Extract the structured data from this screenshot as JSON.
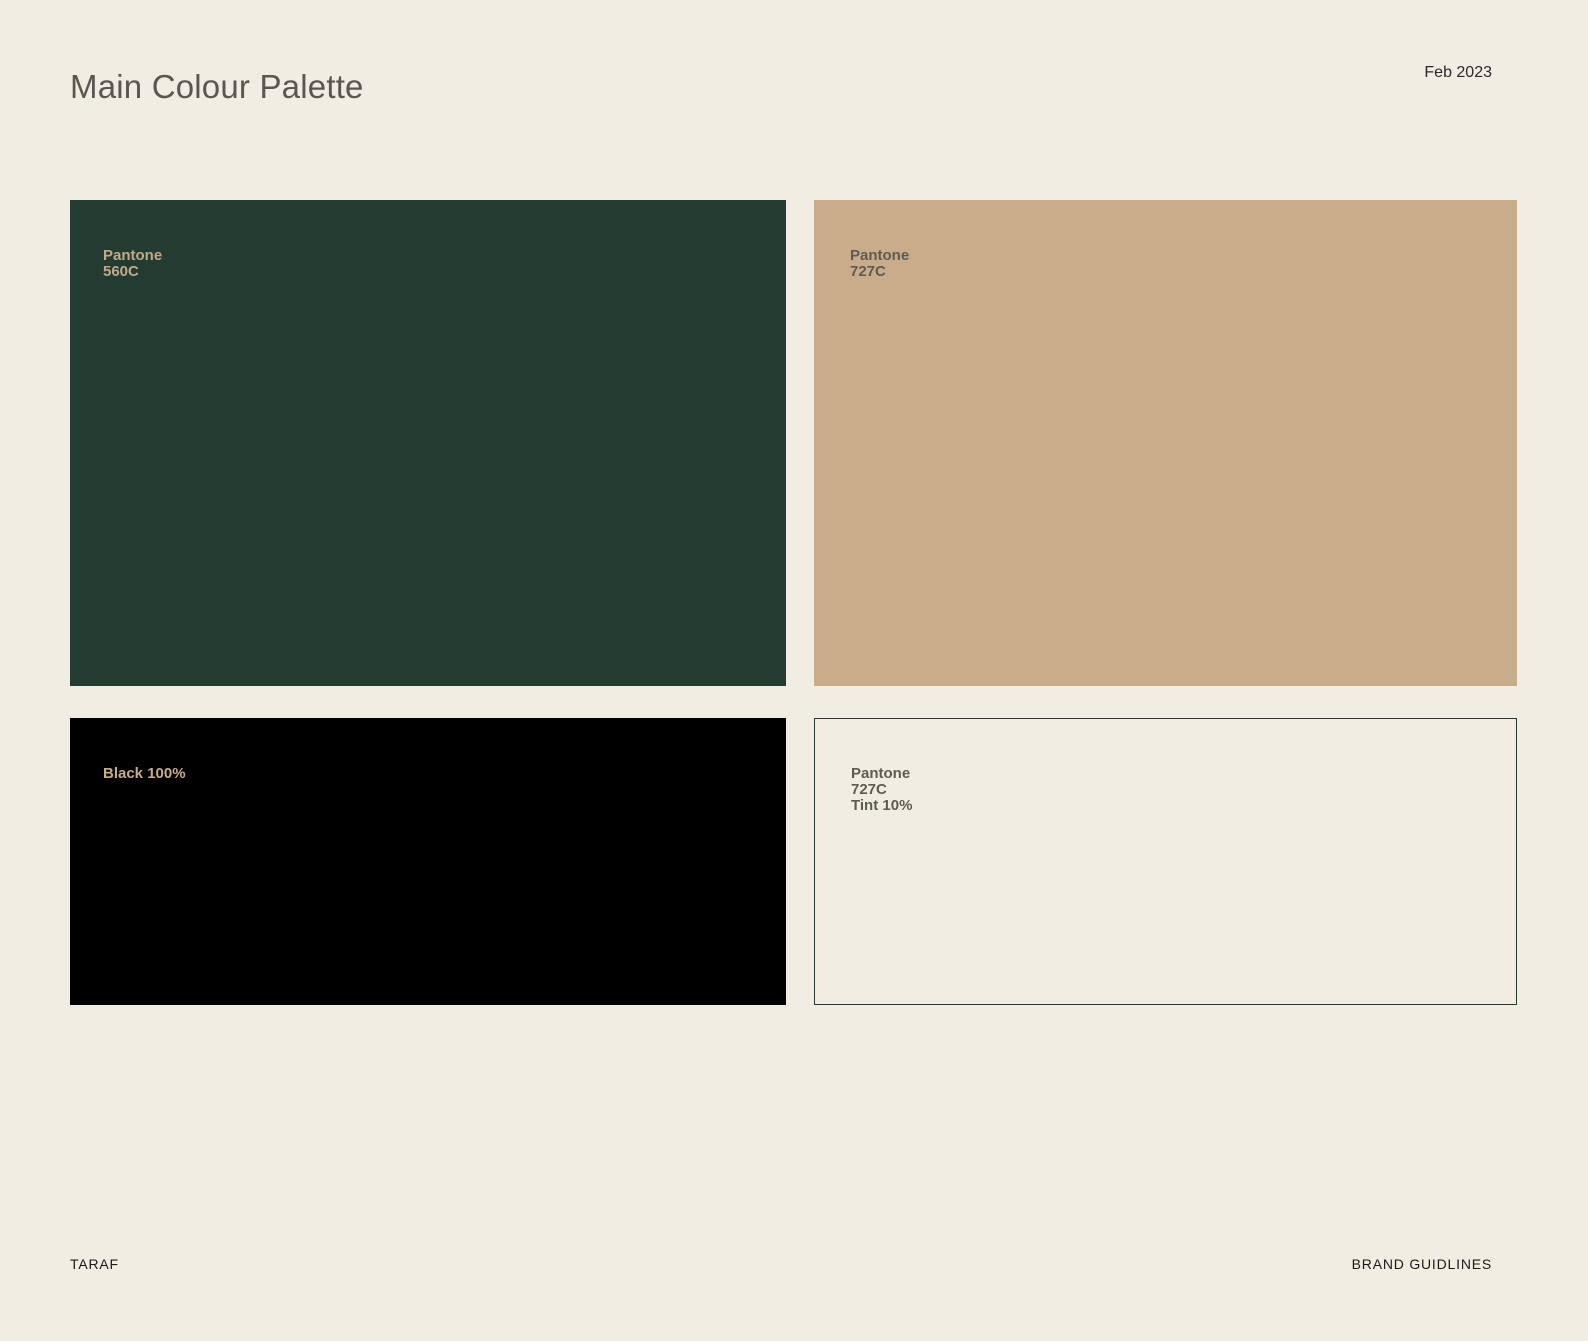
{
  "header": {
    "title": "Main Colour Palette",
    "date": "Feb 2023"
  },
  "swatches": [
    {
      "label": "Pantone\n560C",
      "color": "#233b30",
      "label_color": "#c3a98a"
    },
    {
      "label": "Pantone\n727C",
      "color": "#c9ad8a",
      "label_color": "#5e5a54"
    },
    {
      "label": "Black 100%",
      "color": "#000000",
      "label_color": "#c9ad8a"
    },
    {
      "label": "Pantone\n727C\nTint 10%",
      "color": "#f2ede2",
      "label_color": "#5e5a54",
      "border_color": "#233b30"
    }
  ],
  "footer": {
    "left": "TARAF",
    "right": "BRAND GUIDLINES"
  }
}
